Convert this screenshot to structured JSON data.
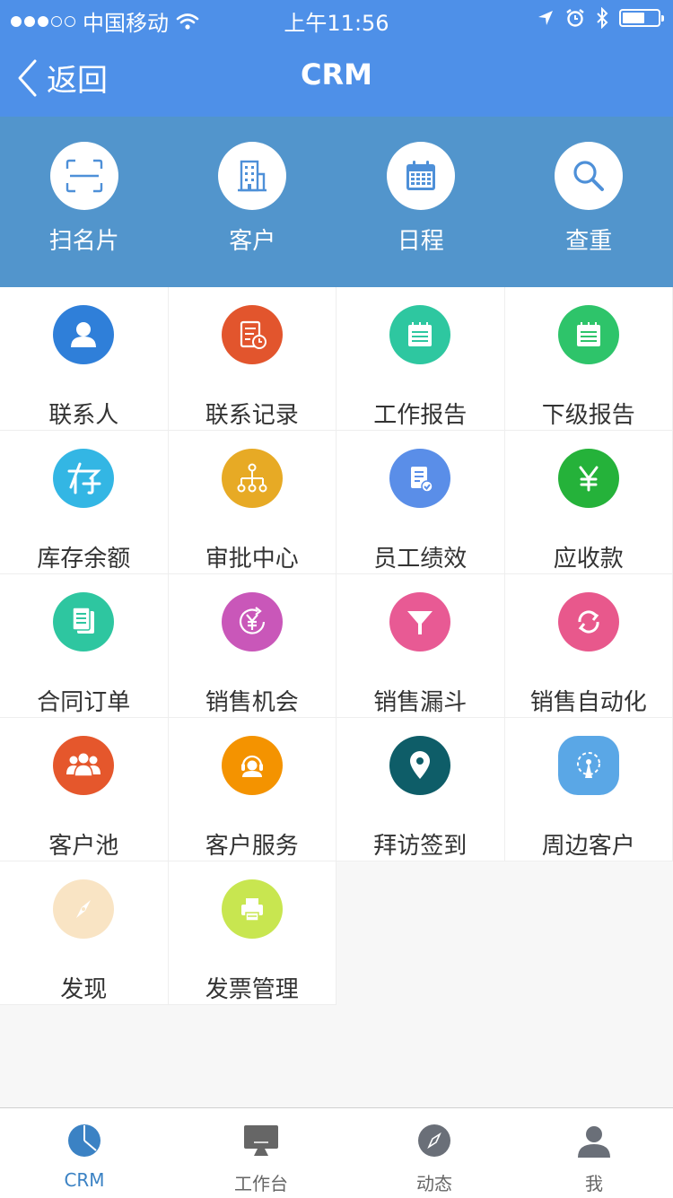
{
  "status_bar": {
    "carrier": "中国移动",
    "time": "上午11:56"
  },
  "nav": {
    "back_label": "返回",
    "title": "CRM"
  },
  "quick_actions": [
    {
      "label": "扫名片",
      "icon": "scan-card-icon"
    },
    {
      "label": "客户",
      "icon": "building-icon"
    },
    {
      "label": "日程",
      "icon": "calendar-icon"
    },
    {
      "label": "查重",
      "icon": "search-icon"
    }
  ],
  "modules": [
    {
      "label": "联系人",
      "icon": "contact-icon",
      "color": "#2f7fd9"
    },
    {
      "label": "联系记录",
      "icon": "record-icon",
      "color": "#e2552d"
    },
    {
      "label": "工作报告",
      "icon": "notepad-icon",
      "color": "#2ec7a0"
    },
    {
      "label": "下级报告",
      "icon": "notepad-icon",
      "color": "#2ec46a"
    },
    {
      "label": "库存余额",
      "icon": "inventory-icon",
      "color": "#33b6e4"
    },
    {
      "label": "审批中心",
      "icon": "hierarchy-icon",
      "color": "#e7aa25"
    },
    {
      "label": "员工绩效",
      "icon": "document-check-icon",
      "color": "#5a8ee8"
    },
    {
      "label": "应收款",
      "icon": "yen-icon",
      "color": "#25b23a"
    },
    {
      "label": "合同订单",
      "icon": "contract-icon",
      "color": "#2ec6a0"
    },
    {
      "label": "销售机会",
      "icon": "yen-cycle-icon",
      "color": "#c957b9"
    },
    {
      "label": "销售漏斗",
      "icon": "funnel-icon",
      "color": "#e85a94"
    },
    {
      "label": "销售自动化",
      "icon": "refresh-icon",
      "color": "#e8588c"
    },
    {
      "label": "客户池",
      "icon": "group-icon",
      "color": "#e5572c"
    },
    {
      "label": "客户服务",
      "icon": "headset-icon",
      "color": "#f49300"
    },
    {
      "label": "拜访签到",
      "icon": "location-pin-icon",
      "color": "#0e5d68"
    },
    {
      "label": "周边客户",
      "icon": "radar-icon",
      "color": "#5aa7e6"
    },
    {
      "label": "发现",
      "icon": "compass-icon",
      "color": "#f9e4c4"
    },
    {
      "label": "发票管理",
      "icon": "printer-icon",
      "color": "#c8e650"
    }
  ],
  "tabs": [
    {
      "label": "CRM",
      "icon": "pie-chart-icon",
      "active": true
    },
    {
      "label": "工作台",
      "icon": "monitor-icon",
      "active": false
    },
    {
      "label": "动态",
      "icon": "compass-icon",
      "active": false
    },
    {
      "label": "我",
      "icon": "user-icon",
      "active": false
    }
  ]
}
